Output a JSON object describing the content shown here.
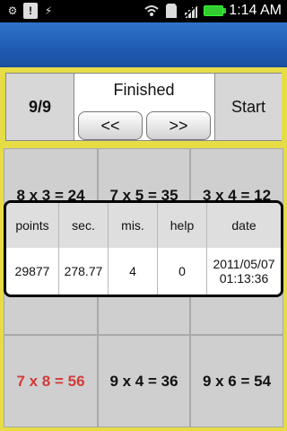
{
  "status_bar": {
    "time": "1:14 AM",
    "left_icons": [
      "usb-debug-icon",
      "warning-icon",
      "usb-icon"
    ],
    "right_icons": [
      "wifi-icon",
      "sd-card-icon",
      "no-signal-icon",
      "battery-icon"
    ]
  },
  "header": {
    "progress": "9/9",
    "status": "Finished",
    "prev_label": "<<",
    "next_label": ">>",
    "start_label": "Start"
  },
  "grid": {
    "tiles": [
      "8 x 3 = 24",
      "7 x 5 = 35",
      "3 x 4 = 12",
      "",
      "",
      "",
      "7 x 8 = 56",
      "9 x 4 = 36",
      "9 x 6 = 54"
    ],
    "highlight_color": "#d43a3a"
  },
  "results": {
    "headers": [
      "points",
      "sec.",
      "mis.",
      "help",
      "date"
    ],
    "row": {
      "points": "29877",
      "sec": "278.77",
      "mis": "4",
      "help": "0",
      "date_line1": "2011/05/07",
      "date_line2": "01:13:36"
    }
  }
}
